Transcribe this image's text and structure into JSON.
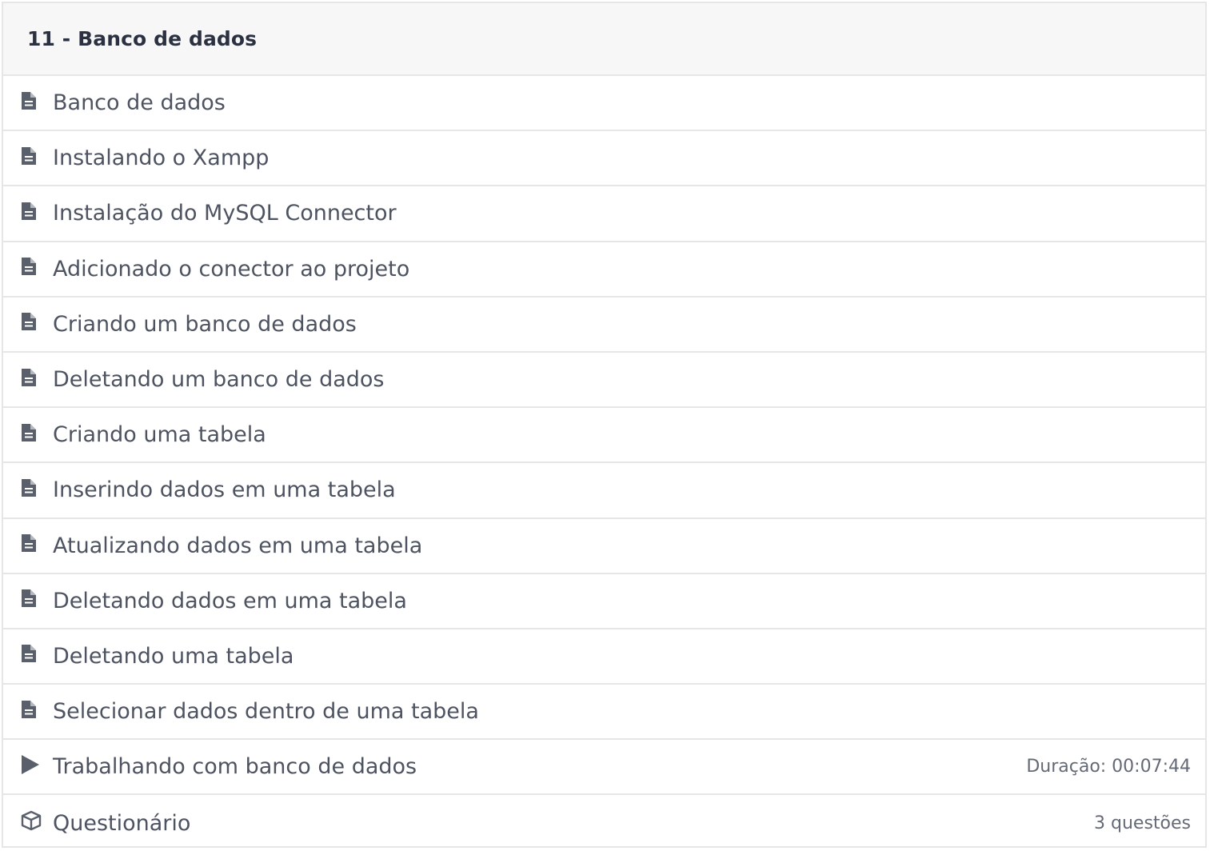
{
  "section": {
    "title": "11 - Banco de dados"
  },
  "lessons": [
    {
      "label": "Banco de dados",
      "icon": "document-icon"
    },
    {
      "label": "Instalando o Xampp",
      "icon": "document-icon"
    },
    {
      "label": "Instalação do MySQL Connector",
      "icon": "document-icon"
    },
    {
      "label": "Adicionado o conector ao projeto",
      "icon": "document-icon"
    },
    {
      "label": "Criando um banco de dados",
      "icon": "document-icon"
    },
    {
      "label": "Deletando um banco de dados",
      "icon": "document-icon"
    },
    {
      "label": "Criando uma tabela",
      "icon": "document-icon"
    },
    {
      "label": "Inserindo dados em uma tabela",
      "icon": "document-icon"
    },
    {
      "label": "Atualizando dados em uma tabela",
      "icon": "document-icon"
    },
    {
      "label": "Deletando dados em uma tabela",
      "icon": "document-icon"
    },
    {
      "label": "Deletando uma tabela",
      "icon": "document-icon"
    },
    {
      "label": "Selecionar dados dentro de uma tabela",
      "icon": "document-icon"
    },
    {
      "label": "Trabalhando com banco de dados",
      "icon": "play-icon",
      "meta": "Duração: 00:07:44"
    },
    {
      "label": "Questionário",
      "icon": "cube-icon",
      "meta": "3 questões"
    }
  ],
  "colors": {
    "border": "#e6e6e6",
    "header_bg": "#f7f7f7",
    "title": "#2b3140",
    "text": "#4d5360",
    "icon": "#5a606b",
    "meta": "#646a75"
  }
}
